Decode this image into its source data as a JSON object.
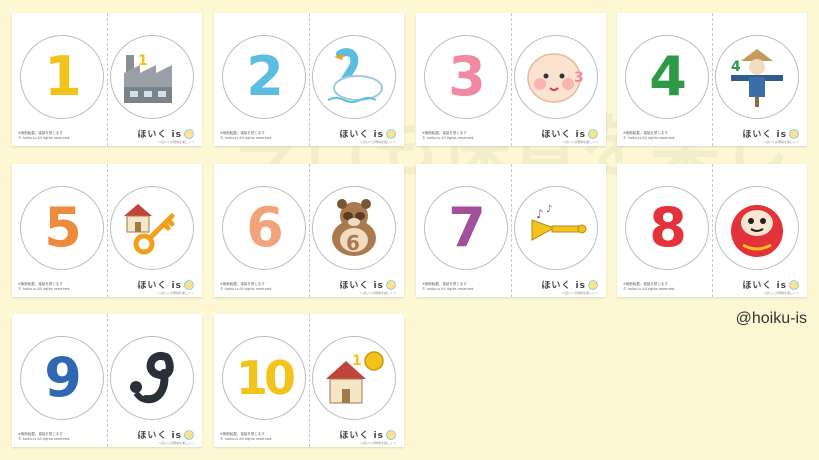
{
  "cards": [
    {
      "number": "1",
      "color": "#f2c31b",
      "picture": "factory-icon"
    },
    {
      "number": "2",
      "color": "#5bbde0",
      "picture": "swan-icon"
    },
    {
      "number": "3",
      "color": "#ef8aa0",
      "picture": "baby-face-icon"
    },
    {
      "number": "4",
      "color": "#2f9a45",
      "picture": "scarecrow-icon"
    },
    {
      "number": "5",
      "color": "#ee8a3c",
      "picture": "house-key-icon"
    },
    {
      "number": "6",
      "color": "#f2a379",
      "picture": "tanuki-icon"
    },
    {
      "number": "7",
      "color": "#a24f9c",
      "picture": "trumpet-icon"
    },
    {
      "number": "8",
      "color": "#e2333a",
      "picture": "daruma-icon"
    },
    {
      "number": "9",
      "color": "#2f67b3",
      "picture": "snake-icon"
    },
    {
      "number": "10",
      "color": "#f2c31b",
      "picture": "house-coin-icon"
    }
  ],
  "card_footer": {
    "copyright_line1": "※無断転載、複製を禁じます",
    "copyright_line2": "© hoiku-is All rights reserved.",
    "brand": "ほいく is",
    "brand_tagline": "〜ほいくの現場を楽しく〜"
  },
  "watermark_text": "今日も保育を楽しく",
  "handle": "@hoiku-is"
}
